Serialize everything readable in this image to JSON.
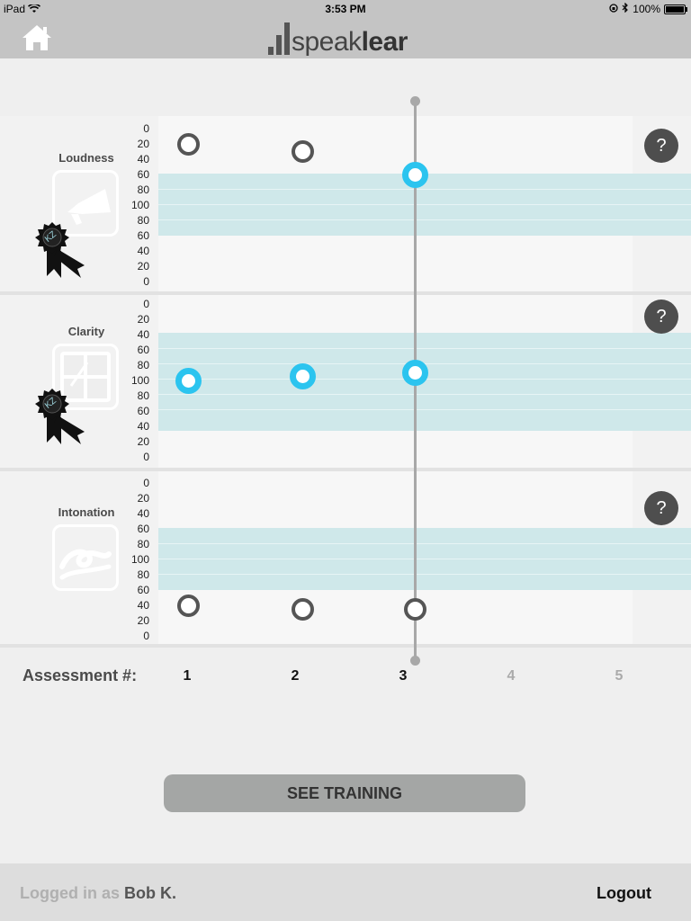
{
  "status": {
    "device": "iPad",
    "time": "3:53 PM",
    "battery": "100%"
  },
  "header": {
    "logo_light": "speak",
    "logo_bold": "lear"
  },
  "panels": [
    {
      "label": "Loudness",
      "scale": [
        "0",
        "20",
        "40",
        "60",
        "80",
        "100",
        "80",
        "60",
        "40",
        "20",
        "0"
      ],
      "help": "?",
      "badge": "KZ",
      "points": [
        {
          "assessment": 1,
          "value": 20,
          "style": "empty"
        },
        {
          "assessment": 2,
          "value": 30,
          "style": "empty"
        },
        {
          "assessment": 3,
          "value": 60,
          "style": "filled"
        }
      ]
    },
    {
      "label": "Clarity",
      "scale": [
        "0",
        "20",
        "40",
        "60",
        "80",
        "100",
        "80",
        "60",
        "40",
        "20",
        "0"
      ],
      "help": "?",
      "badge": "KZ",
      "points": [
        {
          "assessment": 1,
          "value": 100,
          "style": "filled"
        },
        {
          "assessment": 2,
          "value": 95,
          "style": "filled"
        },
        {
          "assessment": 3,
          "value": 90,
          "style": "filled"
        }
      ]
    },
    {
      "label": "Intonation",
      "scale": [
        "0",
        "20",
        "40",
        "60",
        "80",
        "100",
        "80",
        "60",
        "40",
        "20",
        "0"
      ],
      "help": "?",
      "points": [
        {
          "assessment": 1,
          "value": 40,
          "style": "empty"
        },
        {
          "assessment": 2,
          "value": 35,
          "style": "empty"
        },
        {
          "assessment": 3,
          "value": 35,
          "style": "empty"
        }
      ]
    }
  ],
  "assessment": {
    "label": "Assessment #:",
    "numbers": [
      "1",
      "2",
      "3",
      "4",
      "5"
    ],
    "current": 3
  },
  "see_training_label": "SEE TRAINING",
  "footer": {
    "logged_prefix": "Logged in as",
    "user": "Bob K.",
    "logout_label": "Logout"
  },
  "colors": {
    "accent": "#2bc4ef",
    "band": "#cfe8ea",
    "bar": "#c4c4c4"
  }
}
